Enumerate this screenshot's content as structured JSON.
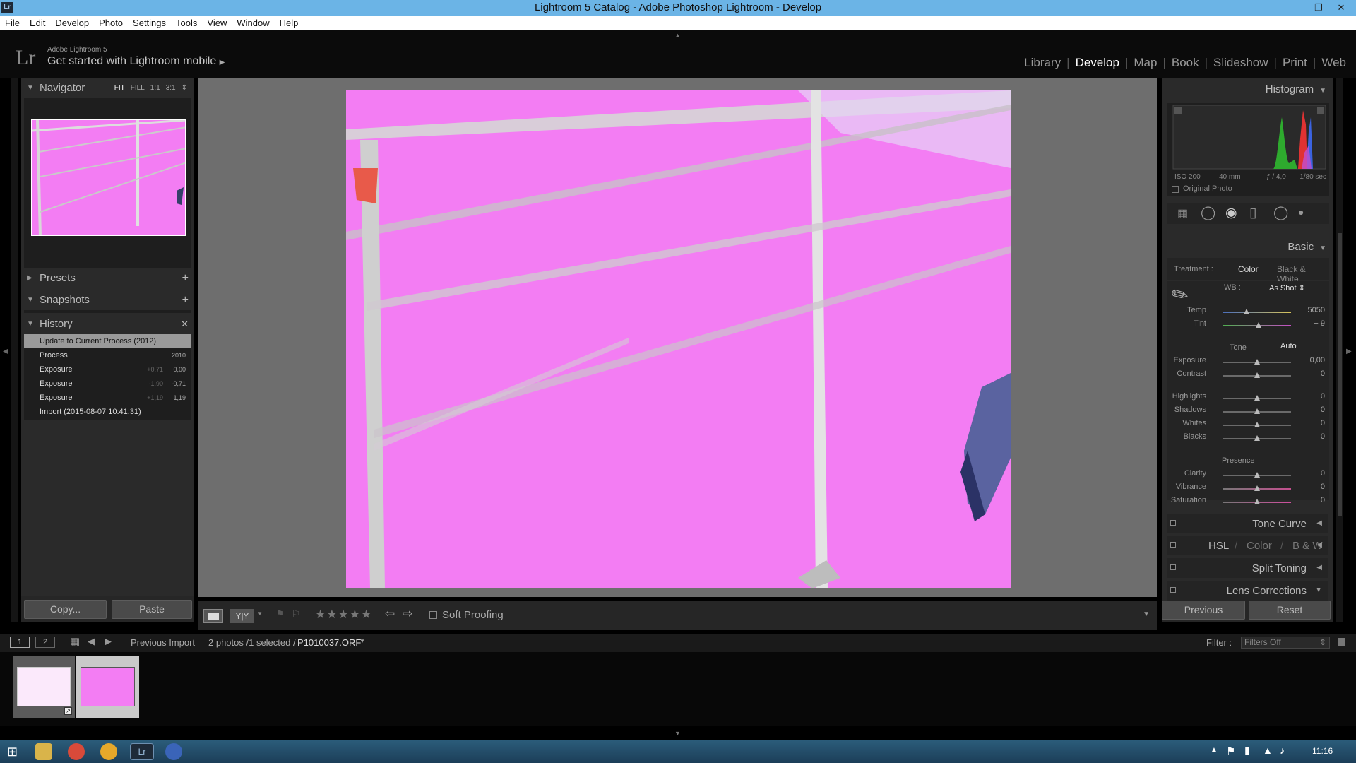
{
  "window": {
    "title": "Lightroom 5 Catalog - Adobe Photoshop Lightroom - Develop",
    "app_badge": "Lr"
  },
  "menu": [
    "File",
    "Edit",
    "Develop",
    "Photo",
    "Settings",
    "Tools",
    "View",
    "Window",
    "Help"
  ],
  "identity": {
    "logo": "Lr",
    "product": "Adobe Lightroom 5",
    "mobile_prompt": "Get started with Lightroom mobile"
  },
  "modules": {
    "library": "Library",
    "develop": "Develop",
    "map": "Map",
    "book": "Book",
    "slideshow": "Slideshow",
    "print": "Print",
    "web": "Web",
    "active": "Develop"
  },
  "navigator": {
    "title": "Navigator",
    "zoom": [
      "FIT",
      "FILL",
      "1:1",
      "3:1"
    ],
    "selected_zoom": "FIT"
  },
  "presets": {
    "title": "Presets"
  },
  "snapshots": {
    "title": "Snapshots"
  },
  "history": {
    "title": "History",
    "items": [
      {
        "label": "Update to Current Process (2012)",
        "v1": "",
        "v2": "",
        "selected": true
      },
      {
        "label": "Process",
        "v1": "",
        "v2": "2010"
      },
      {
        "label": "Exposure",
        "v1": "+0,71",
        "v2": "0,00"
      },
      {
        "label": "Exposure",
        "v1": "-1,90",
        "v2": "-0,71"
      },
      {
        "label": "Exposure",
        "v1": "+1,19",
        "v2": "1,19"
      },
      {
        "label": "Import (2015-08-07 10:41:31)",
        "v1": "",
        "v2": ""
      }
    ]
  },
  "left_buttons": {
    "copy": "Copy...",
    "paste": "Paste"
  },
  "toolbar": {
    "soft_proofing": "Soft Proofing",
    "rating_stars": 5
  },
  "histogram": {
    "title": "Histogram",
    "iso": "ISO 200",
    "focal": "40 mm",
    "aperture": "ƒ / 4,0",
    "shutter": "1/80 sec",
    "original_photo": "Original Photo"
  },
  "basic": {
    "title": "Basic",
    "treatment_label": "Treatment :",
    "color": "Color",
    "bw": "Black & White",
    "wb_label": "WB :",
    "wb_value": "As Shot",
    "tone_label": "Tone",
    "auto": "Auto",
    "presence_label": "Presence",
    "temp": {
      "label": "Temp",
      "value": "5050",
      "pos": 0.35
    },
    "tint": {
      "label": "Tint",
      "value": "+ 9",
      "pos": 0.53
    },
    "exposure": {
      "label": "Exposure",
      "value": "0,00",
      "pos": 0.5
    },
    "contrast": {
      "label": "Contrast",
      "value": "0",
      "pos": 0.5
    },
    "highlights": {
      "label": "Highlights",
      "value": "0",
      "pos": 0.5
    },
    "shadows": {
      "label": "Shadows",
      "value": "0",
      "pos": 0.5
    },
    "whites": {
      "label": "Whites",
      "value": "0",
      "pos": 0.5
    },
    "blacks": {
      "label": "Blacks",
      "value": "0",
      "pos": 0.5
    },
    "clarity": {
      "label": "Clarity",
      "value": "0",
      "pos": 0.5
    },
    "vibrance": {
      "label": "Vibrance",
      "value": "0",
      "pos": 0.5
    },
    "saturation": {
      "label": "Saturation",
      "value": "0",
      "pos": 0.5
    }
  },
  "sections": {
    "tone_curve": "Tone Curve",
    "hsl": "HSL",
    "hsl_color": "Color",
    "hsl_bw": "B & W",
    "split_toning": "Split Toning",
    "lens_corrections": "Lens Corrections"
  },
  "right_buttons": {
    "previous": "Previous",
    "reset": "Reset"
  },
  "filmstrip": {
    "view1": "1",
    "view2": "2",
    "source": "Previous Import",
    "count": "2 photos /1 selected /",
    "filename": "P1010037.ORF",
    "filter_label": "Filter :",
    "filter_value": "Filters Off"
  },
  "taskbar": {
    "time": "11:16"
  },
  "colors": {
    "photo_pink": "#f37df3",
    "titlebar": "#6bb4e6"
  }
}
